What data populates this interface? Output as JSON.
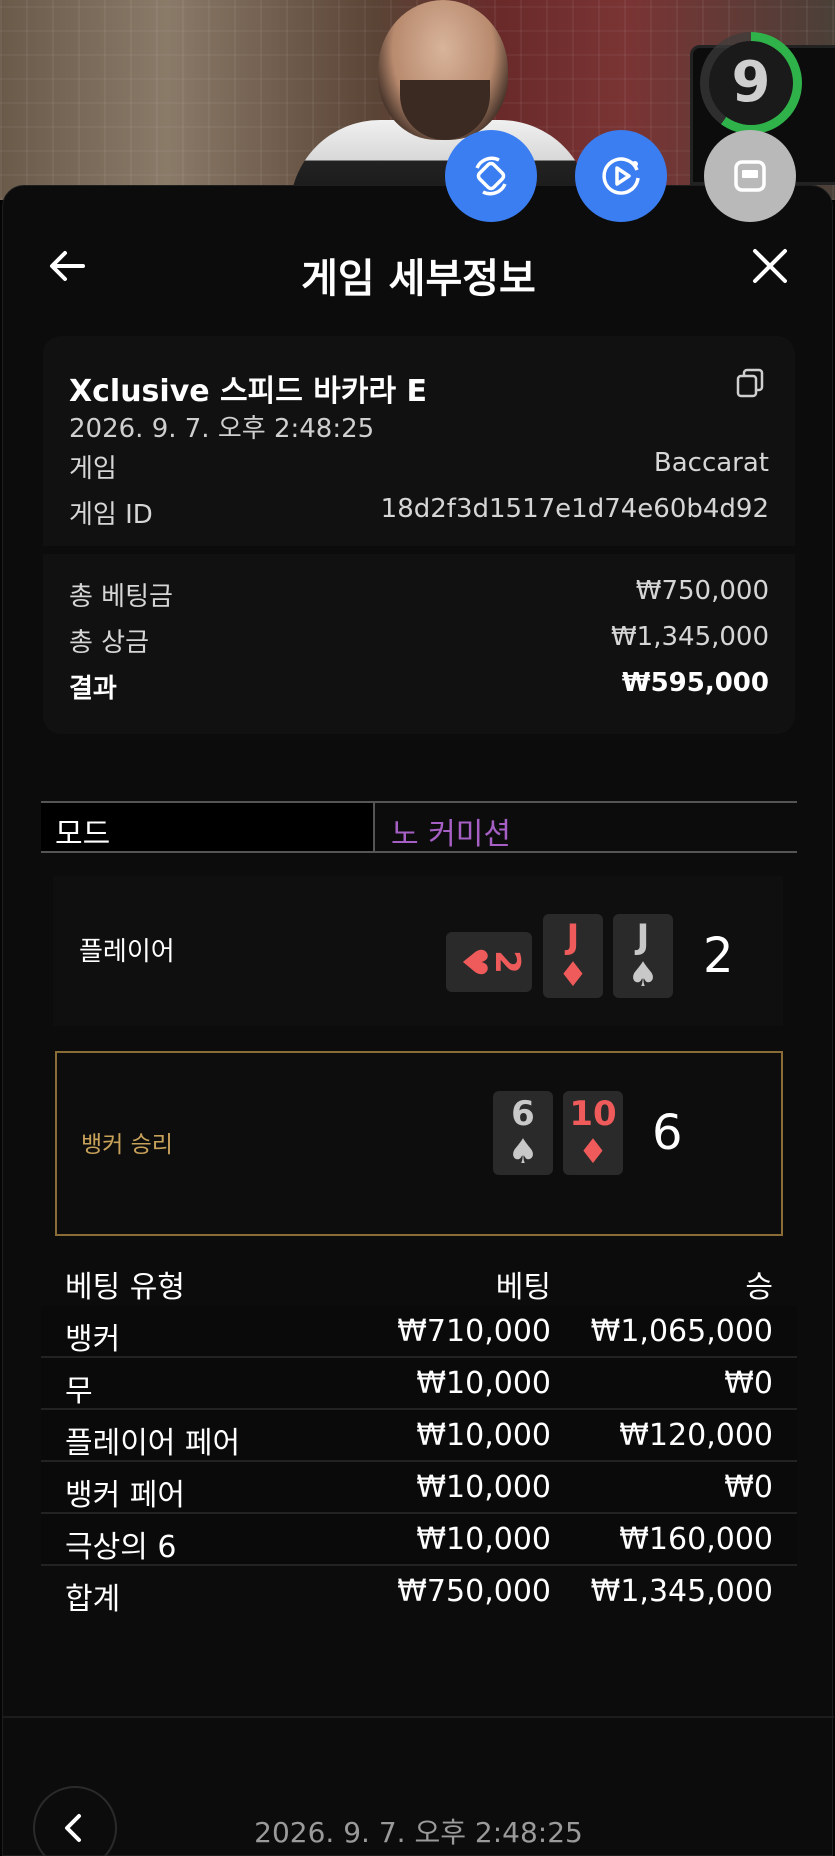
{
  "timer": {
    "value": "9"
  },
  "header": {
    "title": "게임 세부정보"
  },
  "summary": {
    "game_name": "Xclusive 스피드 바카라 E",
    "datetime": "2026. 9. 7. 오후 2:48:25",
    "game_label": "게임",
    "game_value": "Baccarat",
    "id_label": "게임 ID",
    "id_value": "18d2f3d1517e1d74e60b4d92"
  },
  "totals": {
    "bet_label": "총 베팅금",
    "bet_value": "₩750,000",
    "win_label": "총 상금",
    "win_value": "₩1,345,000",
    "result_label": "결과",
    "result_value": "₩595,000"
  },
  "mode": {
    "label": "모드",
    "value": "노 커미션"
  },
  "player": {
    "label": "플레이어",
    "score": "2",
    "cards": [
      {
        "rank": "2",
        "suit": "♥",
        "color": "red",
        "sideways": true
      },
      {
        "rank": "J",
        "suit": "♦",
        "color": "red",
        "sideways": false
      },
      {
        "rank": "J",
        "suit": "♠",
        "color": "black",
        "sideways": false
      }
    ]
  },
  "banker": {
    "label": "뱅커 승리",
    "score": "6",
    "cards": [
      {
        "rank": "6",
        "suit": "♠",
        "color": "black"
      },
      {
        "rank": "10",
        "suit": "♦",
        "color": "red"
      }
    ]
  },
  "bets": {
    "headers": [
      "베팅 유형",
      "베팅",
      "승"
    ],
    "rows": [
      [
        "뱅커",
        "₩710,000",
        "₩1,065,000"
      ],
      [
        "무",
        "₩10,000",
        "₩0"
      ],
      [
        "플레이어 페어",
        "₩10,000",
        "₩120,000"
      ],
      [
        "뱅커 페어",
        "₩10,000",
        "₩0"
      ],
      [
        "극상의 6",
        "₩10,000",
        "₩160,000"
      ]
    ],
    "total": [
      "합계",
      "₩750,000",
      "₩1,345,000"
    ]
  },
  "footer": {
    "datetime": "2026. 9. 7. 오후 2:48:25"
  },
  "colors": {
    "accent_blue": "#3b7ef2",
    "mode_purple": "#a65fc4",
    "banker_gold": "#c9a25a",
    "card_red": "#ef5a5a",
    "timer_green": "#2fb24a"
  }
}
